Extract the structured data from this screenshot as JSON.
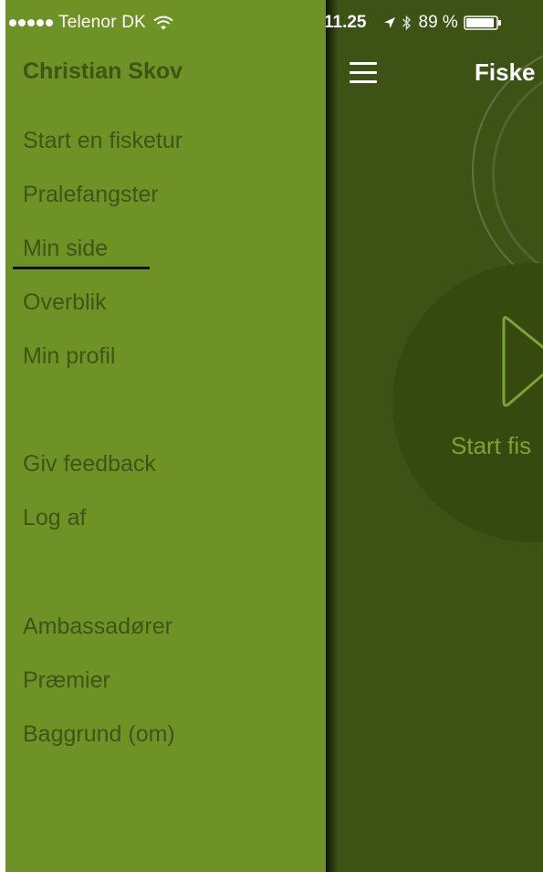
{
  "drawer": {
    "status_bar": {
      "carrier": "Telenor DK"
    },
    "user_name": "Christian Skov",
    "items": [
      {
        "label": "Start en fisketur"
      },
      {
        "label": "Pralefangster"
      },
      {
        "label": "Min side",
        "active": true
      },
      {
        "label": "Overblik"
      },
      {
        "label": "Min profil"
      },
      {
        "label": "Giv feedback"
      },
      {
        "label": "Log af"
      },
      {
        "label": "Ambassadører"
      },
      {
        "label": "Præmier"
      },
      {
        "label": "Baggrund (om)"
      }
    ]
  },
  "main": {
    "status_bar": {
      "time": "11.25",
      "battery": "89 %"
    },
    "title": "Fiske",
    "start_button_label": "Start fis"
  },
  "colors": {
    "drawer_bg": "#6f9226",
    "drawer_text": "#3e5514",
    "main_bg": "#3d5316",
    "circle_bg": "#36490f",
    "accent": "#7da238"
  },
  "icons": [
    "wifi-icon",
    "location-arrow-icon",
    "bluetooth-icon",
    "battery-icon",
    "hamburger-menu-icon",
    "play-icon"
  ]
}
